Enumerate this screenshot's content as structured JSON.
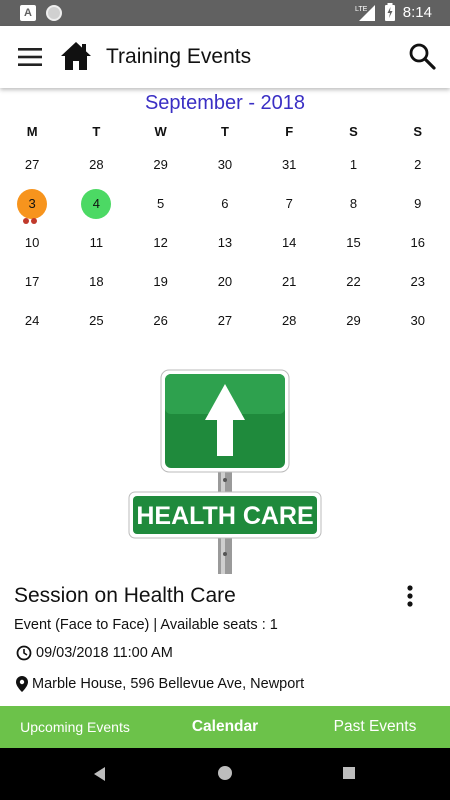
{
  "status_bar": {
    "a_icon": "A",
    "network": "LTE",
    "time": "8:14"
  },
  "app_bar": {
    "title": "Training Events"
  },
  "calendar": {
    "month_title": "September - 2018",
    "weekdays": [
      "M",
      "T",
      "W",
      "T",
      "F",
      "S",
      "S"
    ],
    "weeks": [
      [
        "27",
        "28",
        "29",
        "30",
        "31",
        "1",
        "2"
      ],
      [
        "3",
        "4",
        "5",
        "6",
        "7",
        "8",
        "9"
      ],
      [
        "10",
        "11",
        "12",
        "13",
        "14",
        "15",
        "16"
      ],
      [
        "17",
        "18",
        "19",
        "20",
        "21",
        "22",
        "23"
      ],
      [
        "24",
        "25",
        "26",
        "27",
        "28",
        "29",
        "30"
      ]
    ],
    "selected_day": "3",
    "today": "4",
    "selected_color": "#f7941d",
    "today_color": "#4cd964",
    "event_dot_color": "#c0392b"
  },
  "banner": {
    "sign_text": "HEALTH CARE"
  },
  "event": {
    "title": "Session on Health Care",
    "type_line": "Event (Face to Face) | Available seats : 1",
    "datetime": "09/03/2018 11:00 AM",
    "location": "Marble House, 596 Bellevue Ave, Newport"
  },
  "bottom_nav": {
    "upcoming": "Upcoming Events",
    "calendar": "Calendar",
    "past": "Past Events",
    "bg_color": "#6cc24a"
  }
}
